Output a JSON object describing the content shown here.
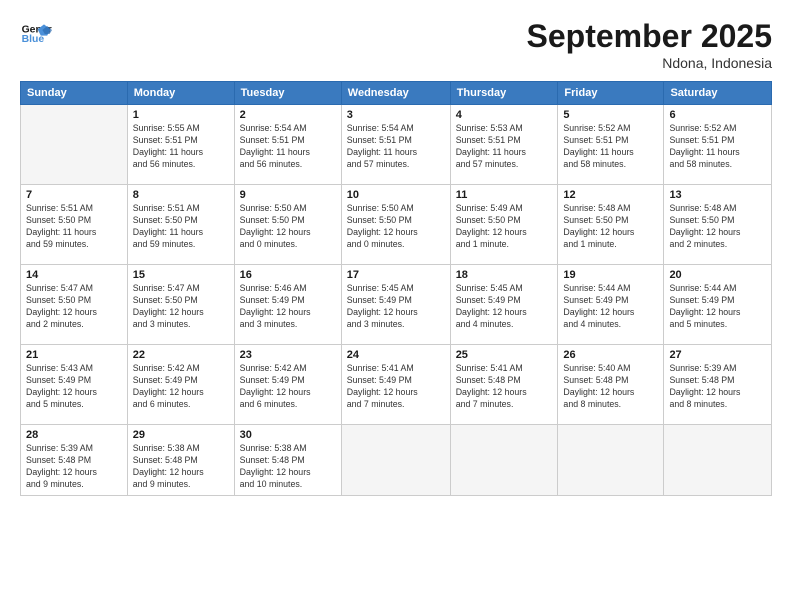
{
  "header": {
    "logo_line1": "General",
    "logo_line2": "Blue",
    "month": "September 2025",
    "location": "Ndona, Indonesia"
  },
  "days_of_week": [
    "Sunday",
    "Monday",
    "Tuesday",
    "Wednesday",
    "Thursday",
    "Friday",
    "Saturday"
  ],
  "weeks": [
    [
      {
        "day": "",
        "info": ""
      },
      {
        "day": "1",
        "info": "Sunrise: 5:55 AM\nSunset: 5:51 PM\nDaylight: 11 hours\nand 56 minutes."
      },
      {
        "day": "2",
        "info": "Sunrise: 5:54 AM\nSunset: 5:51 PM\nDaylight: 11 hours\nand 56 minutes."
      },
      {
        "day": "3",
        "info": "Sunrise: 5:54 AM\nSunset: 5:51 PM\nDaylight: 11 hours\nand 57 minutes."
      },
      {
        "day": "4",
        "info": "Sunrise: 5:53 AM\nSunset: 5:51 PM\nDaylight: 11 hours\nand 57 minutes."
      },
      {
        "day": "5",
        "info": "Sunrise: 5:52 AM\nSunset: 5:51 PM\nDaylight: 11 hours\nand 58 minutes."
      },
      {
        "day": "6",
        "info": "Sunrise: 5:52 AM\nSunset: 5:51 PM\nDaylight: 11 hours\nand 58 minutes."
      }
    ],
    [
      {
        "day": "7",
        "info": "Sunrise: 5:51 AM\nSunset: 5:50 PM\nDaylight: 11 hours\nand 59 minutes."
      },
      {
        "day": "8",
        "info": "Sunrise: 5:51 AM\nSunset: 5:50 PM\nDaylight: 11 hours\nand 59 minutes."
      },
      {
        "day": "9",
        "info": "Sunrise: 5:50 AM\nSunset: 5:50 PM\nDaylight: 12 hours\nand 0 minutes."
      },
      {
        "day": "10",
        "info": "Sunrise: 5:50 AM\nSunset: 5:50 PM\nDaylight: 12 hours\nand 0 minutes."
      },
      {
        "day": "11",
        "info": "Sunrise: 5:49 AM\nSunset: 5:50 PM\nDaylight: 12 hours\nand 1 minute."
      },
      {
        "day": "12",
        "info": "Sunrise: 5:48 AM\nSunset: 5:50 PM\nDaylight: 12 hours\nand 1 minute."
      },
      {
        "day": "13",
        "info": "Sunrise: 5:48 AM\nSunset: 5:50 PM\nDaylight: 12 hours\nand 2 minutes."
      }
    ],
    [
      {
        "day": "14",
        "info": "Sunrise: 5:47 AM\nSunset: 5:50 PM\nDaylight: 12 hours\nand 2 minutes."
      },
      {
        "day": "15",
        "info": "Sunrise: 5:47 AM\nSunset: 5:50 PM\nDaylight: 12 hours\nand 3 minutes."
      },
      {
        "day": "16",
        "info": "Sunrise: 5:46 AM\nSunset: 5:49 PM\nDaylight: 12 hours\nand 3 minutes."
      },
      {
        "day": "17",
        "info": "Sunrise: 5:45 AM\nSunset: 5:49 PM\nDaylight: 12 hours\nand 3 minutes."
      },
      {
        "day": "18",
        "info": "Sunrise: 5:45 AM\nSunset: 5:49 PM\nDaylight: 12 hours\nand 4 minutes."
      },
      {
        "day": "19",
        "info": "Sunrise: 5:44 AM\nSunset: 5:49 PM\nDaylight: 12 hours\nand 4 minutes."
      },
      {
        "day": "20",
        "info": "Sunrise: 5:44 AM\nSunset: 5:49 PM\nDaylight: 12 hours\nand 5 minutes."
      }
    ],
    [
      {
        "day": "21",
        "info": "Sunrise: 5:43 AM\nSunset: 5:49 PM\nDaylight: 12 hours\nand 5 minutes."
      },
      {
        "day": "22",
        "info": "Sunrise: 5:42 AM\nSunset: 5:49 PM\nDaylight: 12 hours\nand 6 minutes."
      },
      {
        "day": "23",
        "info": "Sunrise: 5:42 AM\nSunset: 5:49 PM\nDaylight: 12 hours\nand 6 minutes."
      },
      {
        "day": "24",
        "info": "Sunrise: 5:41 AM\nSunset: 5:49 PM\nDaylight: 12 hours\nand 7 minutes."
      },
      {
        "day": "25",
        "info": "Sunrise: 5:41 AM\nSunset: 5:48 PM\nDaylight: 12 hours\nand 7 minutes."
      },
      {
        "day": "26",
        "info": "Sunrise: 5:40 AM\nSunset: 5:48 PM\nDaylight: 12 hours\nand 8 minutes."
      },
      {
        "day": "27",
        "info": "Sunrise: 5:39 AM\nSunset: 5:48 PM\nDaylight: 12 hours\nand 8 minutes."
      }
    ],
    [
      {
        "day": "28",
        "info": "Sunrise: 5:39 AM\nSunset: 5:48 PM\nDaylight: 12 hours\nand 9 minutes."
      },
      {
        "day": "29",
        "info": "Sunrise: 5:38 AM\nSunset: 5:48 PM\nDaylight: 12 hours\nand 9 minutes."
      },
      {
        "day": "30",
        "info": "Sunrise: 5:38 AM\nSunset: 5:48 PM\nDaylight: 12 hours\nand 10 minutes."
      },
      {
        "day": "",
        "info": ""
      },
      {
        "day": "",
        "info": ""
      },
      {
        "day": "",
        "info": ""
      },
      {
        "day": "",
        "info": ""
      }
    ]
  ]
}
